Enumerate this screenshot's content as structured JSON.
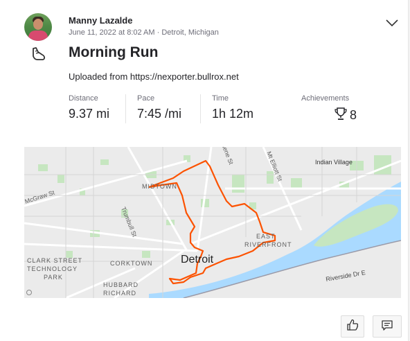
{
  "athlete": {
    "name": "Manny Lazalde",
    "meta": "June 11, 2022 at 8:02 AM · Detroit, Michigan"
  },
  "activity": {
    "title": "Morning Run",
    "description": "Uploaded from https://nexporter.bullrox.net",
    "icon": "running-shoe-icon"
  },
  "stats": [
    {
      "label": "Distance",
      "value": "9.37 mi"
    },
    {
      "label": "Pace",
      "value": "7:45 /mi"
    },
    {
      "label": "Time",
      "value": "1h 12m"
    }
  ],
  "achievements": {
    "label": "Achievements",
    "value": "8",
    "icon": "trophy-icon"
  },
  "map": {
    "labels": {
      "indian_village": "Indian Village",
      "mcgraw": "McGraw St",
      "midtown": "MIDTOWN",
      "trumbull": "Trumbull St",
      "gratiot": "iene St",
      "mt_elliott": "Mt Elliott St",
      "east_riverfront_1": "EAST",
      "east_riverfront_2": "RIVERFRONT",
      "detroit": "Detroit",
      "clark_street_1": "CLARK STREET",
      "clark_street_2": "TECHNOLOGY",
      "clark_street_3": "PARK",
      "corktown": "CORKTOWN",
      "hubbard_1": "HUBBARD",
      "hubbard_2": "RICHARD",
      "riverside": "Riverside Dr E"
    },
    "colors": {
      "route": "#fc5200",
      "water": "#aadaff",
      "park": "#c6e6c0",
      "land": "#ebebeb",
      "road": "#ffffff"
    }
  },
  "actions": {
    "kudos_icon": "thumbs-up-icon",
    "comment_icon": "comment-icon"
  }
}
